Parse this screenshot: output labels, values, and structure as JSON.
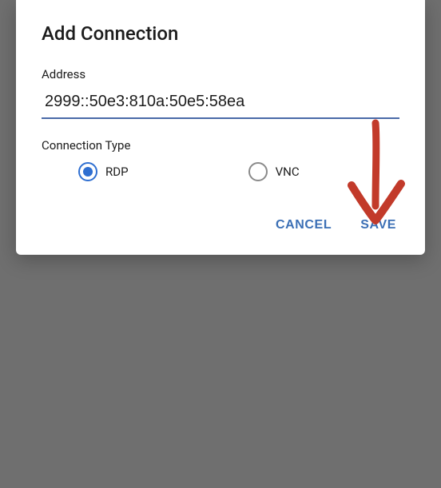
{
  "dialog": {
    "title": "Add Connection",
    "address": {
      "label": "Address",
      "value": "2999::50e3:810a:50e5:58ea"
    },
    "connectionType": {
      "label": "Connection Type",
      "options": {
        "rdp": "RDP",
        "vnc": "VNC"
      },
      "selected": "rdp"
    },
    "actions": {
      "cancel": "CANCEL",
      "save": "SAVE"
    }
  },
  "colors": {
    "accent": "#3b6fb5",
    "radioSelected": "#2f6fd1",
    "underline": "#4a6aa8",
    "annotation": "#c0392b"
  }
}
